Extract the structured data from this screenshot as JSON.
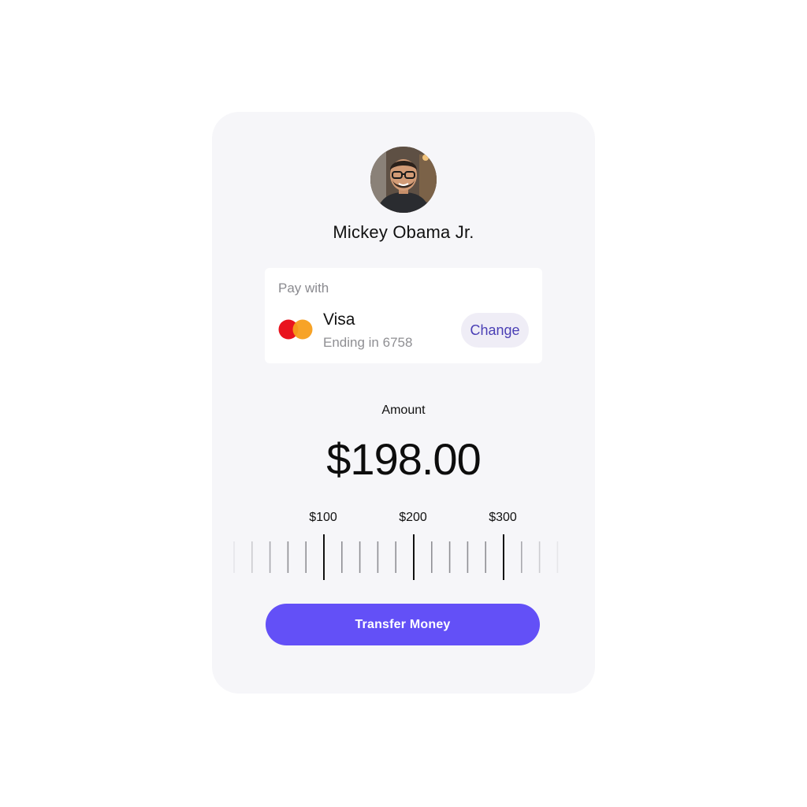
{
  "recipient": {
    "name": "Mickey Obama Jr."
  },
  "payment": {
    "label": "Pay with",
    "card_brand": "Visa",
    "card_ending": "Ending in 6758",
    "change_label": "Change",
    "logo_colors": {
      "left": "#e9141e",
      "right": "#f79e1b"
    }
  },
  "amount": {
    "label": "Amount",
    "value": "$198.00"
  },
  "slider": {
    "labels": [
      "$100",
      "$200",
      "$300"
    ],
    "current_value": 198
  },
  "actions": {
    "transfer_label": "Transfer Money"
  },
  "colors": {
    "accent": "#6350f7",
    "card_background": "#f6f6f9"
  }
}
